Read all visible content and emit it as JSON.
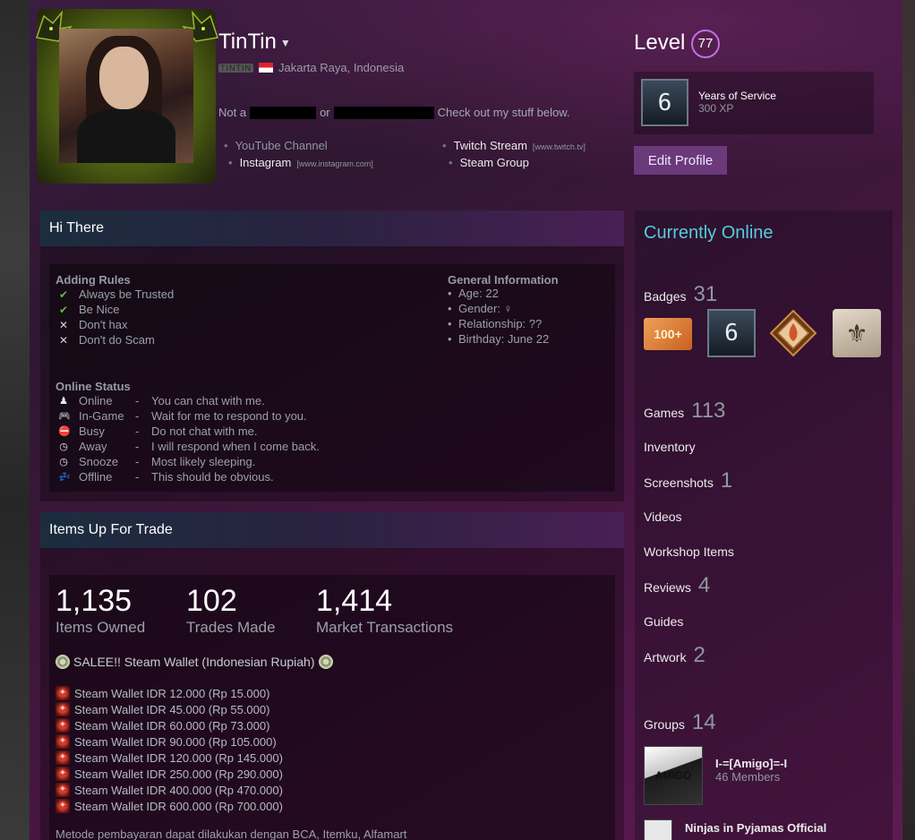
{
  "profile": {
    "persona_name": "TinTin",
    "real_name": "TINTIN",
    "location": "Jakarta Raya, Indonesia",
    "summary_start": "Not a",
    "summary_or": "or",
    "summary_end": "Check out my stuff below.",
    "links": [
      {
        "label": "YouTube Channel",
        "host": ""
      },
      {
        "label": "Twitch Stream",
        "host": "[www.twitch.tv]"
      },
      {
        "label": "Instagram",
        "host": "[www.instagram.com]"
      },
      {
        "label": "Steam Group",
        "host": ""
      }
    ]
  },
  "level": {
    "label": "Level",
    "value": "77",
    "badge_title": "Years of Service",
    "badge_xp": "300 XP",
    "badge_number": "6",
    "edit_button": "Edit Profile"
  },
  "showcase1": {
    "title": "Hi There",
    "rules_title": "Adding Rules",
    "rules": [
      {
        "icon": "check",
        "text": "Always be Trusted"
      },
      {
        "icon": "check",
        "text": "Be Nice"
      },
      {
        "icon": "cross",
        "text": "Don't hax"
      },
      {
        "icon": "cross",
        "text": "Don't do Scam"
      }
    ],
    "info_title": "General Information",
    "info": [
      "Age: 22",
      "Gender: ♀",
      "Relationship: ??",
      "Birthday: June 22"
    ],
    "status_title": "Online Status",
    "statuses": [
      {
        "icon": "♟",
        "name": "Online",
        "desc": "You can chat with me."
      },
      {
        "icon": "🎮",
        "name": "In-Game",
        "desc": "Wait for me to respond to you."
      },
      {
        "icon": "⛔",
        "name": "Busy",
        "desc": "Do not chat with me."
      },
      {
        "icon": "◷",
        "name": "Away",
        "desc": "I will respond when I come back."
      },
      {
        "icon": "◷",
        "name": "Snooze",
        "desc": "Most likely sleeping."
      },
      {
        "icon": "💤",
        "name": "Offline",
        "desc": "This should be obvious."
      }
    ],
    "dash": "-"
  },
  "showcase2": {
    "title": "Items Up For Trade",
    "stats": [
      {
        "value": "1,135",
        "label": "Items Owned"
      },
      {
        "value": "102",
        "label": "Trades Made"
      },
      {
        "value": "1,414",
        "label": "Market Transactions"
      }
    ],
    "sale_title": "SALEE!! Steam Wallet (Indonesian Rupiah)",
    "wallet_items": [
      "Steam Wallet IDR 12.000 (Rp 15.000)",
      "Steam Wallet IDR 45.000 (Rp 55.000)",
      "Steam Wallet IDR 60.000 (Rp 73.000)",
      "Steam Wallet IDR 90.000 (Rp 105.000)",
      "Steam Wallet IDR 120.000 (Rp 145.000)",
      "Steam Wallet IDR 250.000 (Rp 290.000)",
      "Steam Wallet IDR 400.000 (Rp 470.000)",
      "Steam Wallet IDR 600.000 (Rp 700.000)"
    ],
    "payment_text": "Metode pembayaran dapat dilakukan dengan BCA, Itemku, Alfamart"
  },
  "sidebar": {
    "status": "Currently Online",
    "badges_label": "Badges",
    "badges_count": "31",
    "badge_items": [
      {
        "text": "100+"
      },
      {
        "text": "6"
      },
      {
        "text": ""
      },
      {
        "text": "⚜"
      }
    ],
    "games_label": "Games",
    "games_count": "113",
    "inventory_label": "Inventory",
    "screenshots_label": "Screenshots",
    "screenshots_count": "1",
    "videos_label": "Videos",
    "workshop_label": "Workshop Items",
    "reviews_label": "Reviews",
    "reviews_count": "4",
    "guides_label": "Guides",
    "artwork_label": "Artwork",
    "artwork_count": "2",
    "groups_label": "Groups",
    "groups_count": "14",
    "groups": [
      {
        "name": "I-=[Amigo]=-I",
        "members": "46 Members",
        "avatar_text": "AMIGO"
      },
      {
        "name": "Ninjas in Pyjamas Official",
        "members": "",
        "avatar_text": ""
      }
    ]
  }
}
